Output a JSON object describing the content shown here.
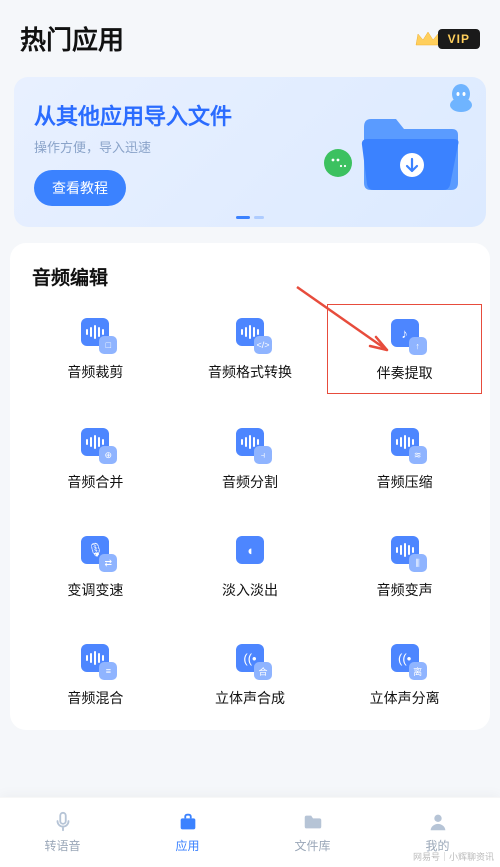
{
  "header": {
    "title": "热门应用",
    "vip_label": "VIP"
  },
  "banner": {
    "title": "从其他应用导入文件",
    "subtitle": "操作方便，导入迅速",
    "button": "查看教程"
  },
  "section": {
    "title": "音频编辑",
    "tools": [
      {
        "label": "音频裁剪",
        "sub": "□",
        "highlighted": false
      },
      {
        "label": "音频格式转换",
        "sub": "</>",
        "highlighted": false
      },
      {
        "label": "伴奏提取",
        "sub": "↑",
        "highlighted": true,
        "primary_glyph": "♪"
      },
      {
        "label": "音频合并",
        "sub": "⊕",
        "highlighted": false
      },
      {
        "label": "音频分割",
        "sub": "⫞",
        "highlighted": false
      },
      {
        "label": "音频压缩",
        "sub": "≋",
        "highlighted": false
      },
      {
        "label": "变调变速",
        "sub": "⇄",
        "highlighted": false,
        "primary_glyph": "🎙"
      },
      {
        "label": "淡入淡出",
        "sub": "",
        "highlighted": false,
        "primary_glyph": "◖"
      },
      {
        "label": "音频变声",
        "sub": "⫼",
        "highlighted": false
      },
      {
        "label": "音频混合",
        "sub": "≡",
        "highlighted": false
      },
      {
        "label": "立体声合成",
        "sub": "合",
        "highlighted": false,
        "primary_glyph": "((•"
      },
      {
        "label": "立体声分离",
        "sub": "离",
        "highlighted": false,
        "primary_glyph": "((•"
      }
    ]
  },
  "tabs": [
    {
      "label": "转语音",
      "icon": "mic",
      "active": false
    },
    {
      "label": "应用",
      "icon": "briefcase",
      "active": true
    },
    {
      "label": "文件库",
      "icon": "folder",
      "active": false
    },
    {
      "label": "我的",
      "icon": "person",
      "active": false
    }
  ],
  "watermark": "网易号｜小辉聊资讯"
}
